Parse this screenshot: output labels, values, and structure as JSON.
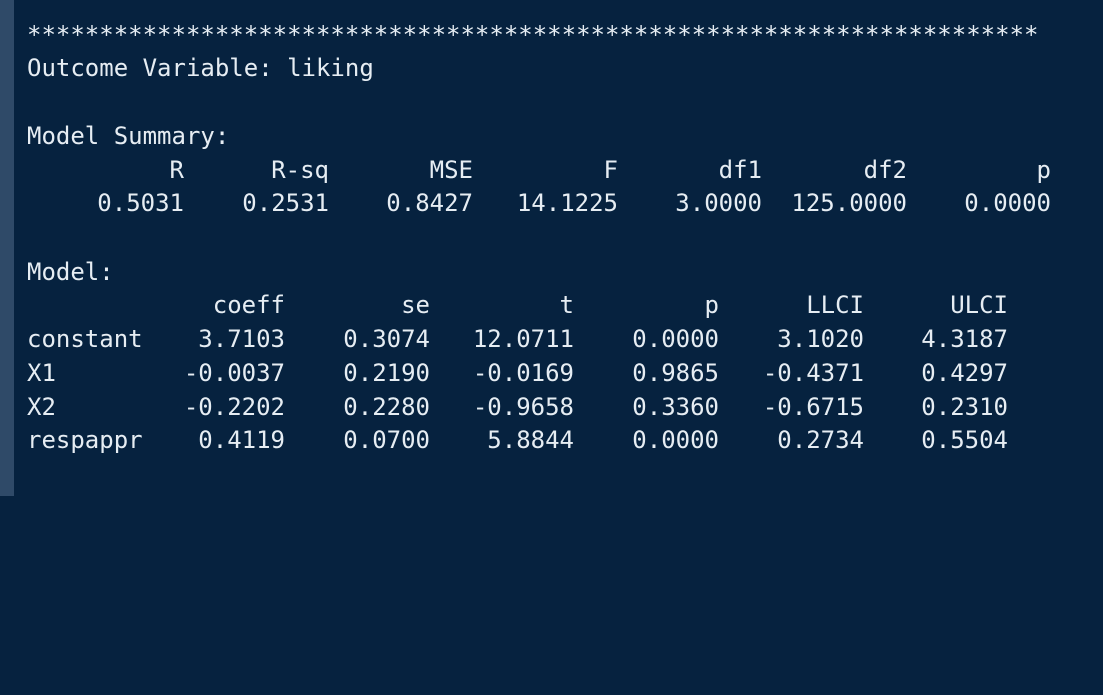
{
  "separator": "**********************************************************************",
  "outcome_line": "Outcome Variable: liking",
  "model_summary": {
    "title": "Model Summary:",
    "headers": [
      "R",
      "R-sq",
      "MSE",
      "F",
      "df1",
      "df2",
      "p"
    ],
    "values": [
      "0.5031",
      "0.2531",
      "0.8427",
      "14.1225",
      "3.0000",
      "125.0000",
      "0.0000"
    ]
  },
  "model": {
    "title": "Model:",
    "headers": [
      "coeff",
      "se",
      "t",
      "p",
      "LLCI",
      "ULCI"
    ],
    "rows": [
      {
        "label": "constant",
        "values": [
          "3.7103",
          "0.3074",
          "12.0711",
          "0.0000",
          "3.1020",
          "4.3187"
        ]
      },
      {
        "label": "X1",
        "values": [
          "-0.0037",
          "0.2190",
          "-0.0169",
          "0.9865",
          "-0.4371",
          "0.4297"
        ]
      },
      {
        "label": "X2",
        "values": [
          "-0.2202",
          "0.2280",
          "-0.9658",
          "0.3360",
          "-0.6715",
          "0.2310"
        ]
      },
      {
        "label": "respappr",
        "values": [
          "0.4119",
          "0.0700",
          "5.8844",
          "0.0000",
          "0.2734",
          "0.5504"
        ]
      }
    ]
  },
  "colors": {
    "background": "#06223f",
    "text": "#e6edf3",
    "border": "#2f4a68"
  }
}
